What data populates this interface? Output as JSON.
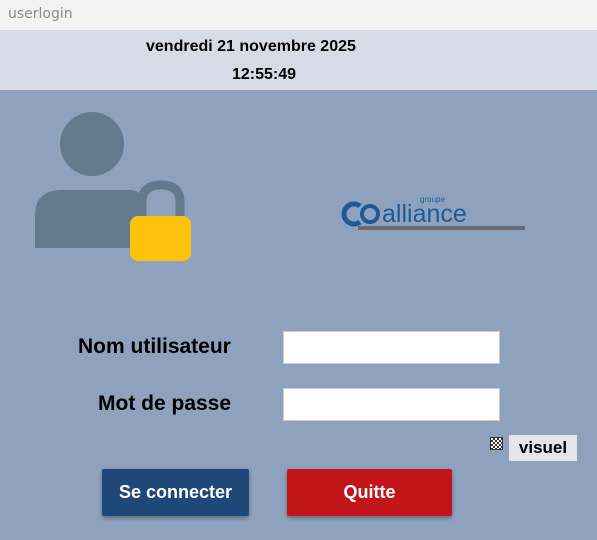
{
  "window": {
    "title": "userlogin"
  },
  "header": {
    "date": "vendredi 21 novembre 2025",
    "time": "12:55:49"
  },
  "logo": {
    "small_text": "groupe",
    "main_text": "alliance"
  },
  "form": {
    "username_label": "Nom utilisateur",
    "username_value": "",
    "password_label": "Mot de passe",
    "password_value": "",
    "show_password_label": "visuel"
  },
  "buttons": {
    "connect_label": "Se connecter",
    "quit_label": "Quitte"
  },
  "colors": {
    "background": "#8fa2bd",
    "header": "#d6dce6",
    "connect_button": "#1f4777",
    "quit_button": "#c2161b",
    "lock": "#fdc20c",
    "user_icon": "#627a8b",
    "logo_blue": "#1e5a97"
  },
  "icons": {
    "user": "user-icon",
    "lock": "lock-icon",
    "visuel_toggle": "checkbox-icon"
  }
}
